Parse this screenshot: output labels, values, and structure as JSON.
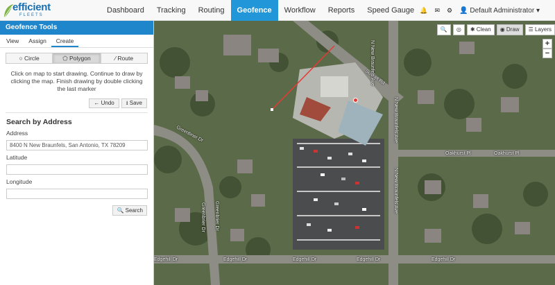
{
  "logo": {
    "word": "efficient",
    "sub": "FLEETS"
  },
  "nav": {
    "items": [
      "Dashboard",
      "Tracking",
      "Routing",
      "Geofence",
      "Workflow",
      "Reports",
      "Speed Gauge"
    ],
    "active": "Geofence",
    "user": "Default Administrator"
  },
  "sidebar": {
    "header": "Geofence Tools",
    "tabs": [
      "View",
      "Assign",
      "Create"
    ],
    "active_tab": "Create",
    "modes": [
      "Circle",
      "Polygon",
      "Route"
    ],
    "active_mode": "Polygon",
    "instructions": "Click on map to start drawing. Continue to draw by clicking the map. Finish drawing by double clicking the last marker",
    "undo": "Undo",
    "save": "Save",
    "search_title": "Search by Address",
    "address_label": "Address",
    "address_value": "8400 N New Braunfels, San Antonio, TX 78209",
    "latitude_label": "Latitude",
    "latitude_value": "",
    "longitude_label": "Longitude",
    "longitude_value": "",
    "search_button": "Search"
  },
  "map": {
    "toolbar": {
      "clean": "Clean",
      "draw": "Draw",
      "layers": "Layers"
    },
    "zoom_in": "+",
    "zoom_out": "−",
    "streets": {
      "e_sunset": "Sunset Rd",
      "n_new_braunfels_top": "N New Braunfels Ave",
      "oakhurst_1": "Oakhurst Pl",
      "oakhurst_2": "Oakhurst Pl",
      "n_new_braunfels_mid": "N New Braunfels Ave",
      "n_new_braunfels_low": "N New Braunfels Ave",
      "greenbrier": "Greenbrier Dr",
      "n_greenbrier": "Greenbrier Dr",
      "edgehill_1": "Edgehill Dr",
      "edgehill_2": "Edgehill Dr",
      "edgehill_3": "Edgehill Dr",
      "edgehill_4": "Edgehill Dr",
      "edgehill_left": "Edgehill Dr",
      "left_vertical": "Greenbrier Dr",
      "right_vertical": "N New Braunfels Ave"
    }
  }
}
